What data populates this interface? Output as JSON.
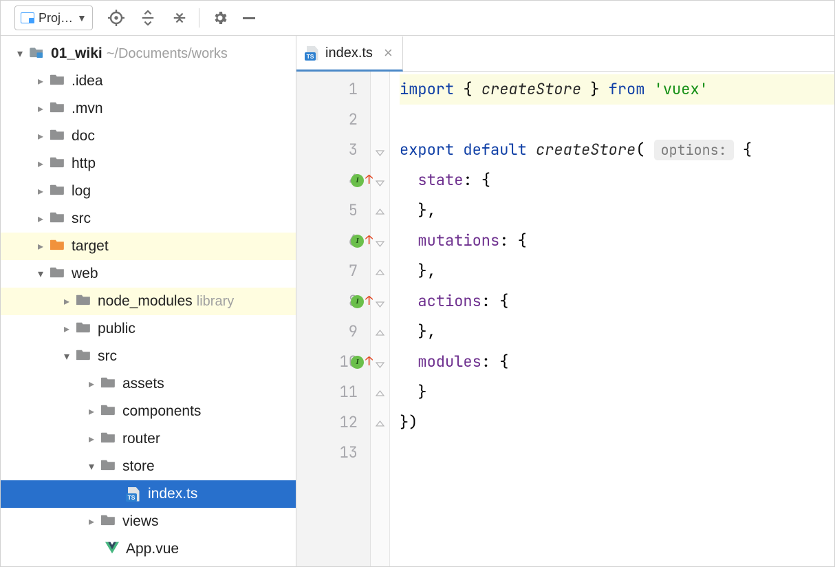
{
  "toolbar": {
    "dropdown_label": "Proj…"
  },
  "tree": {
    "root_name": "01_wiki",
    "root_path": "~/Documents/works",
    "idea": ".idea",
    "mvn": ".mvn",
    "doc": "doc",
    "http": "http",
    "log": "log",
    "src": "src",
    "target": "target",
    "web": "web",
    "node_modules": "node_modules",
    "node_modules_note": "library",
    "public": "public",
    "web_src": "src",
    "assets": "assets",
    "components": "components",
    "router": "router",
    "store": "store",
    "index_ts": "index.ts",
    "views": "views",
    "app_vue": "App.vue"
  },
  "tab": {
    "filename": "index.ts"
  },
  "code": {
    "kw_import": "import",
    "kw_from": "from",
    "kw_export": "export",
    "kw_default": "default",
    "fn_createStore": "createStore",
    "str_vuex": "'vuex'",
    "hint_options": "options:",
    "prop_state": "state",
    "prop_mutations": "mutations",
    "prop_actions": "actions",
    "prop_modules": "modules",
    "lines": [
      "1",
      "2",
      "3",
      "4",
      "5",
      "6",
      "7",
      "8",
      "9",
      "10",
      "11",
      "12",
      "13"
    ]
  }
}
